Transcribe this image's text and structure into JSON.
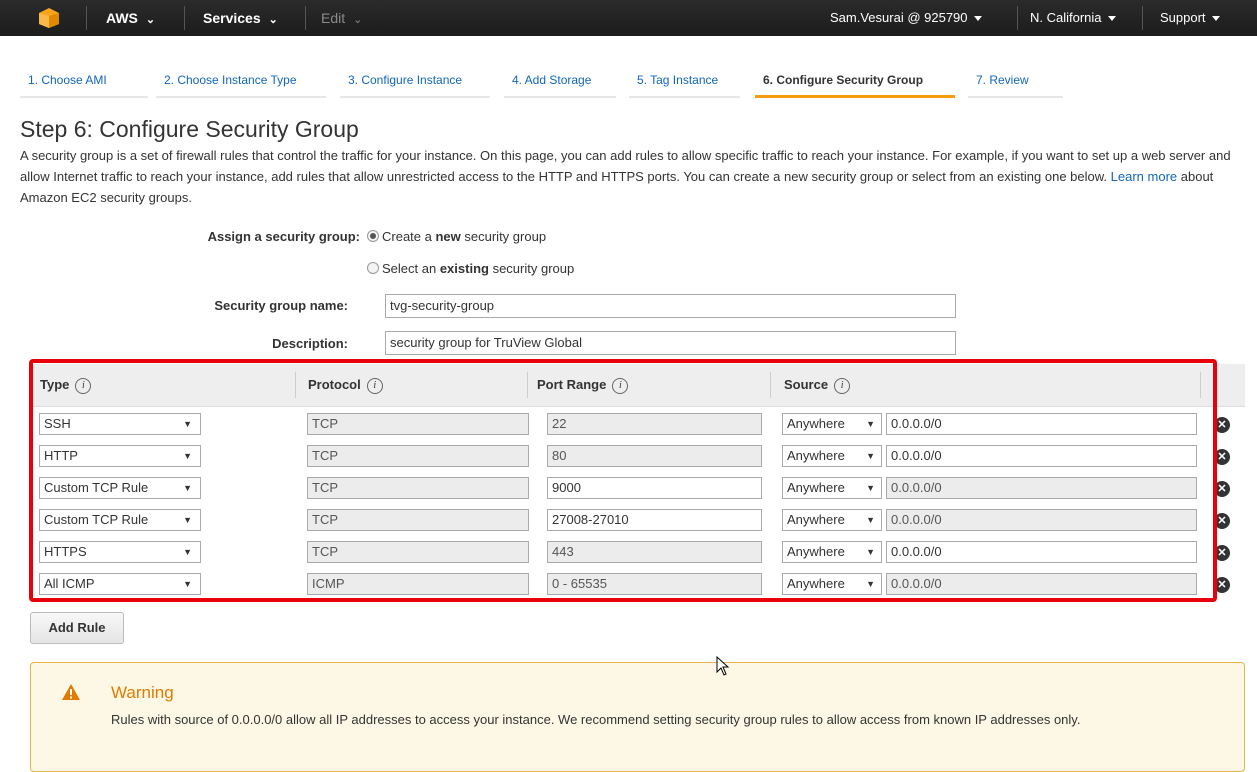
{
  "topnav": {
    "aws_label": "AWS",
    "services_label": "Services",
    "edit_label": "Edit",
    "account_label": "Sam.Vesurai @ 925790",
    "region_label": "N. California",
    "support_label": "Support"
  },
  "steps": [
    {
      "label": "1. Choose AMI"
    },
    {
      "label": "2. Choose Instance Type"
    },
    {
      "label": "3. Configure Instance"
    },
    {
      "label": "4. Add Storage"
    },
    {
      "label": "5. Tag Instance"
    },
    {
      "label": "6. Configure Security Group",
      "active": true
    },
    {
      "label": "7. Review"
    }
  ],
  "page": {
    "title": "Step 6: Configure Security Group",
    "intro_text": "A security group is a set of firewall rules that control the traffic for your instance. On this page, you can add rules to allow specific traffic to reach your instance. For example, if you want to set up a web server and allow Internet traffic to reach your instance, add rules that allow unrestricted access to the HTTP and HTTPS ports. You can create a new security group or select from an existing one below.",
    "learn_more": "Learn more",
    "intro_tail": "about Amazon EC2 security groups."
  },
  "assign": {
    "label": "Assign a security group:",
    "option_new_pre": "Create a ",
    "option_new_bold": "new",
    "option_new_post": " security group",
    "option_existing_pre": "Select an ",
    "option_existing_bold": "existing",
    "option_existing_post": " security group",
    "selected": "new"
  },
  "form": {
    "name_label": "Security group name:",
    "name_value": "tvg-security-group",
    "desc_label": "Description:",
    "desc_value": "security group for TruView Global"
  },
  "table": {
    "headers": [
      "Type",
      "Protocol",
      "Port Range",
      "Source"
    ],
    "info_glyph": "i",
    "rows": [
      {
        "type": "SSH",
        "protocol": "TCP",
        "port": "22",
        "port_editable": false,
        "source": "Anywhere",
        "cidr": "0.0.0.0/0",
        "cidr_editable": true
      },
      {
        "type": "HTTP",
        "protocol": "TCP",
        "port": "80",
        "port_editable": false,
        "source": "Anywhere",
        "cidr": "0.0.0.0/0",
        "cidr_editable": true
      },
      {
        "type": "Custom TCP Rule",
        "protocol": "TCP",
        "port": "9000",
        "port_editable": true,
        "source": "Anywhere",
        "cidr": "0.0.0.0/0",
        "cidr_editable": false
      },
      {
        "type": "Custom TCP Rule",
        "protocol": "TCP",
        "port": "27008-27010",
        "port_editable": true,
        "source": "Anywhere",
        "cidr": "0.0.0.0/0",
        "cidr_editable": false
      },
      {
        "type": "HTTPS",
        "protocol": "TCP",
        "port": "443",
        "port_editable": false,
        "source": "Anywhere",
        "cidr": "0.0.0.0/0",
        "cidr_editable": true
      },
      {
        "type": "All ICMP",
        "protocol": "ICMP",
        "port": "0 - 65535",
        "port_editable": false,
        "source": "Anywhere",
        "cidr": "0.0.0.0/0",
        "cidr_editable": false
      }
    ]
  },
  "add_rule_label": "Add Rule",
  "warning": {
    "title": "Warning",
    "message": "Rules with source of 0.0.0.0/0 allow all IP addresses to access your instance. We recommend setting security group rules to allow access from known IP addresses only."
  },
  "colors": {
    "nav_bg": "#1c1c1c",
    "link": "#1166bb",
    "active_step_underline": "#f39c12",
    "highlight_box": "#e8000b",
    "warning_border": "#e9b34b",
    "warning_title": "#e07a00"
  }
}
